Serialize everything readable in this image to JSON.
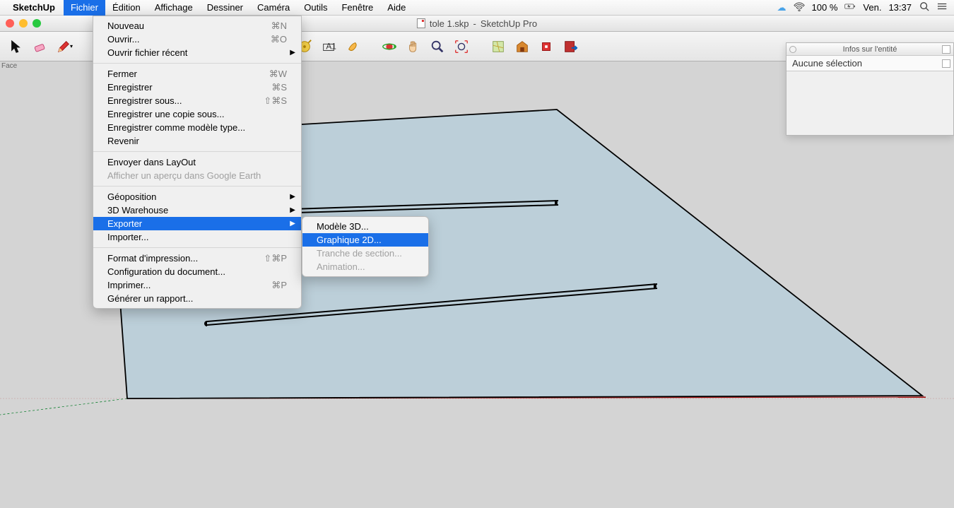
{
  "menubar": {
    "app": "SketchUp",
    "items": [
      "Fichier",
      "Édition",
      "Affichage",
      "Dessiner",
      "Caméra",
      "Outils",
      "Fenêtre",
      "Aide"
    ],
    "active_index": 0,
    "battery": "100 %",
    "day": "Ven.",
    "time": "13:37"
  },
  "window": {
    "doc": "tole 1.skp",
    "app_title": "SketchUp Pro"
  },
  "topleft_label": "Face",
  "file_menu": {
    "groups": [
      [
        {
          "label": "Nouveau",
          "shortcut": "⌘N"
        },
        {
          "label": "Ouvrir...",
          "shortcut": "⌘O"
        },
        {
          "label": "Ouvrir fichier récent",
          "submenu": true
        }
      ],
      [
        {
          "label": "Fermer",
          "shortcut": "⌘W"
        },
        {
          "label": "Enregistrer",
          "shortcut": "⌘S"
        },
        {
          "label": "Enregistrer sous...",
          "shortcut": "⇧⌘S"
        },
        {
          "label": "Enregistrer une copie sous..."
        },
        {
          "label": "Enregistrer comme modèle type..."
        },
        {
          "label": "Revenir"
        }
      ],
      [
        {
          "label": "Envoyer dans LayOut"
        },
        {
          "label": "Afficher un aperçu dans Google Earth",
          "disabled": true
        }
      ],
      [
        {
          "label": "Géoposition",
          "submenu": true
        },
        {
          "label": "3D Warehouse",
          "submenu": true
        },
        {
          "label": "Exporter",
          "submenu": true,
          "highlighted": true
        },
        {
          "label": "Importer..."
        }
      ],
      [
        {
          "label": "Format d'impression...",
          "shortcut": "⇧⌘P"
        },
        {
          "label": "Configuration du document..."
        },
        {
          "label": "Imprimer...",
          "shortcut": "⌘P"
        },
        {
          "label": "Générer un rapport..."
        }
      ]
    ]
  },
  "export_submenu": [
    {
      "label": "Modèle 3D..."
    },
    {
      "label": "Graphique 2D...",
      "highlighted": true
    },
    {
      "label": "Tranche de section...",
      "disabled": true
    },
    {
      "label": "Animation...",
      "disabled": true
    }
  ],
  "panel": {
    "title": "Infos sur l'entité",
    "selection": "Aucune sélection"
  }
}
